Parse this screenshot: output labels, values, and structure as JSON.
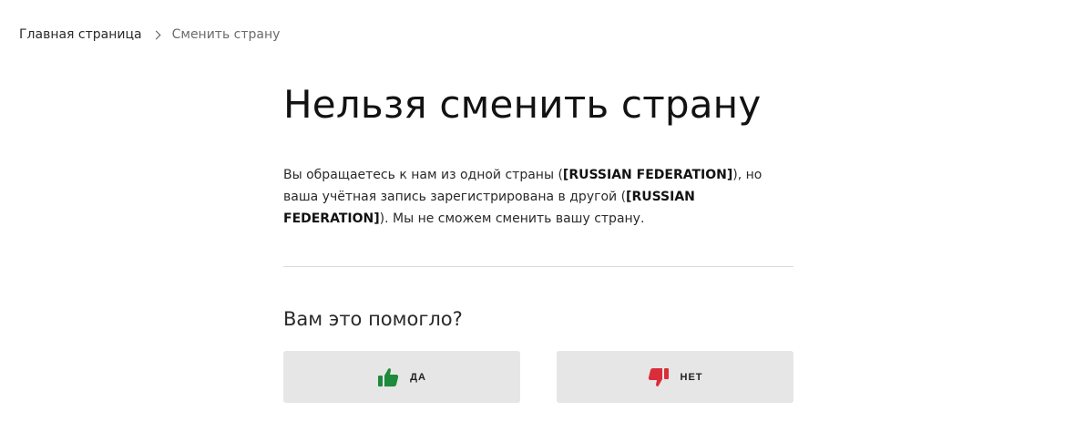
{
  "breadcrumb": {
    "home": "Главная страница",
    "current": "Сменить страну"
  },
  "page": {
    "title": "Нельзя сменить страну",
    "message_part1": "Вы обращаетесь к нам из одной страны (",
    "country_request": "[RUSSIAN FEDERATION]",
    "message_part2": "), но ваша учётная запись зарегистрирована в другой (",
    "country_account": "[RUSSIAN FEDERATION]",
    "message_part3": "). Мы не сможем сменить вашу страну."
  },
  "feedback": {
    "question": "Вам это помогло?",
    "yes_label": "ДА",
    "no_label": "НЕТ",
    "yes_icon": "thumbs-up-icon",
    "no_icon": "thumbs-down-icon",
    "yes_color": "#1e8a3c",
    "no_color": "#d92d3a"
  }
}
